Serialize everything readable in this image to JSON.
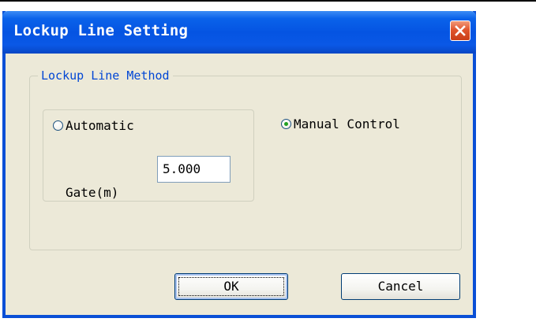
{
  "dialog": {
    "title": "Lockup Line Setting"
  },
  "group": {
    "legend": "Lockup Line Method",
    "automatic_label": "Automatic",
    "manual_label": "Manual Control",
    "selected": "manual"
  },
  "gate": {
    "label": "Gate(m)",
    "value": "5.000"
  },
  "buttons": {
    "ok_label": "OK",
    "cancel_label": "Cancel"
  },
  "colors": {
    "title_bar": "#0554e2",
    "dialog_bg": "#ece9d8",
    "legend_text": "#0046d5",
    "close_button": "#e0552d"
  }
}
